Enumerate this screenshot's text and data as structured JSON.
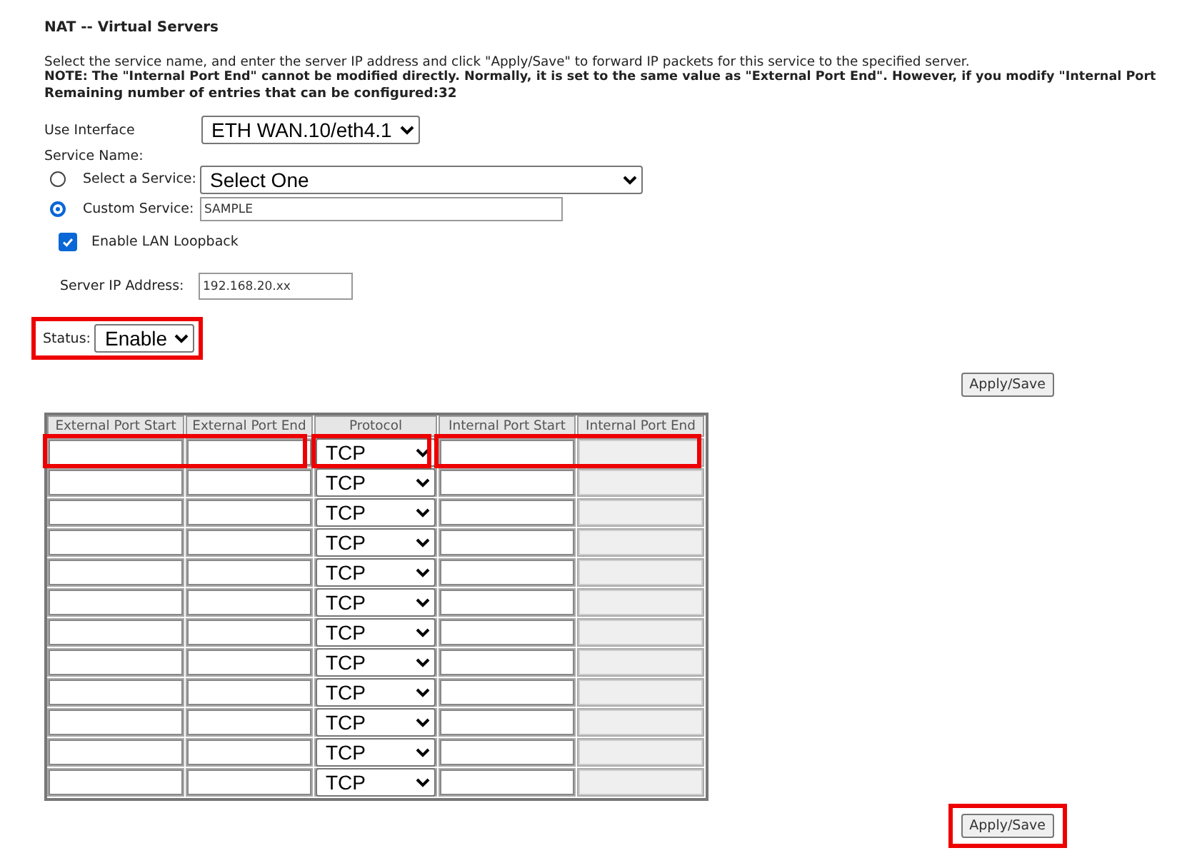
{
  "title": "NAT -- Virtual Servers",
  "intro": "Select the service name, and enter the server IP address and click \"Apply/Save\" to forward IP packets for this service to the specified server.",
  "note": "NOTE: The \"Internal Port End\" cannot be modified directly. Normally, it is set to the same value as \"External Port End\". However, if you modify \"Internal Port",
  "remaining": "Remaining number of entries that can be configured:32",
  "interface": {
    "label": "Use Interface",
    "value": "ETH WAN.10/eth4.1"
  },
  "service_name_label": "Service Name:",
  "services": [
    {
      "kind": "select",
      "label": "Select a Service:",
      "value": "Select One",
      "selected": false
    },
    {
      "kind": "text",
      "label": "Custom Service:",
      "value": "SAMPLE",
      "selected": true
    }
  ],
  "lan_loopback": {
    "label": "Enable LAN Loopback",
    "checked": true
  },
  "server_ip": {
    "label": "Server IP Address:",
    "value": "192.168.20.xx"
  },
  "status": {
    "label": "Status:",
    "value": "Enable",
    "highlighted": true
  },
  "apply_top": {
    "label": "Apply/Save",
    "highlighted": false
  },
  "table": {
    "columns": [
      {
        "label": "External Port Start",
        "kind": "input"
      },
      {
        "label": "External Port End",
        "kind": "input"
      },
      {
        "label": "Protocol",
        "kind": "select"
      },
      {
        "label": "Internal Port Start",
        "kind": "input"
      },
      {
        "label": "Internal Port End",
        "kind": "readonly"
      }
    ],
    "rows": [
      {
        "protocol": "TCP",
        "highlighted": true
      },
      {
        "protocol": "TCP",
        "highlighted": false
      },
      {
        "protocol": "TCP",
        "highlighted": false
      },
      {
        "protocol": "TCP",
        "highlighted": false
      },
      {
        "protocol": "TCP",
        "highlighted": false
      },
      {
        "protocol": "TCP",
        "highlighted": false
      },
      {
        "protocol": "TCP",
        "highlighted": false
      },
      {
        "protocol": "TCP",
        "highlighted": false
      },
      {
        "protocol": "TCP",
        "highlighted": false
      },
      {
        "protocol": "TCP",
        "highlighted": false
      },
      {
        "protocol": "TCP",
        "highlighted": false
      },
      {
        "protocol": "TCP",
        "highlighted": false
      }
    ]
  },
  "apply_bottom": {
    "label": "Apply/Save",
    "highlighted": true
  }
}
